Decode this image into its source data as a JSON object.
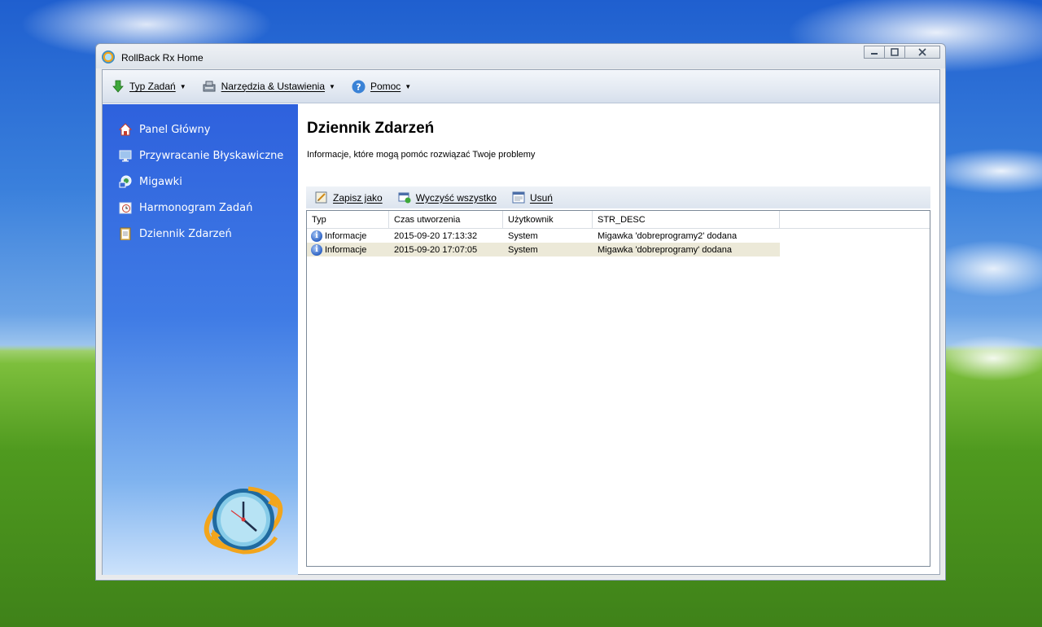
{
  "window": {
    "title": "RollBack Rx Home",
    "buttons": {
      "minimize": "—",
      "maximize": "□",
      "close": "✕"
    }
  },
  "menubar": {
    "items": [
      {
        "label": "Typ Zadań",
        "icon": "download-arrow-icon"
      },
      {
        "label": "Narzędzia & Ustawienia",
        "icon": "tools-icon"
      },
      {
        "label": "Pomoc",
        "icon": "help-icon"
      }
    ]
  },
  "sidebar": {
    "items": [
      {
        "label": "Panel Główny",
        "icon": "home-icon"
      },
      {
        "label": "Przywracanie Błyskawiczne",
        "icon": "monitor-icon"
      },
      {
        "label": "Migawki",
        "icon": "snapshot-icon"
      },
      {
        "label": "Harmonogram Zadań",
        "icon": "schedule-clock-icon"
      },
      {
        "label": "Dziennik Zdarzeń",
        "icon": "log-clipboard-icon"
      }
    ]
  },
  "main": {
    "title": "Dziennik Zdarzeń",
    "subtitle": "Informacje, które mogą pomóc rozwiązać Twoje problemy",
    "toolbar": [
      {
        "label": "Zapisz jako",
        "icon": "save-as-icon"
      },
      {
        "label": "Wyczyść wszystko",
        "icon": "clear-all-icon"
      },
      {
        "label": "Usuń",
        "icon": "delete-icon"
      }
    ],
    "table": {
      "columns": [
        "Typ",
        "Czas utworzenia",
        "Użytkownik",
        "STR_DESC"
      ],
      "rows": [
        {
          "type": "Informacje",
          "time": "2015-09-20 17:13:32",
          "user": "System",
          "desc": "Migawka 'dobreprogramy2' dodana",
          "selected": false
        },
        {
          "type": "Informacje",
          "time": "2015-09-20 17:07:05",
          "user": "System",
          "desc": "Migawka 'dobreprogramy' dodana",
          "selected": true
        }
      ]
    }
  },
  "colors": {
    "sidebar_top": "#2e61dd",
    "sidebar_bottom": "#cce2fb",
    "selected_row": "#ece9d8"
  }
}
